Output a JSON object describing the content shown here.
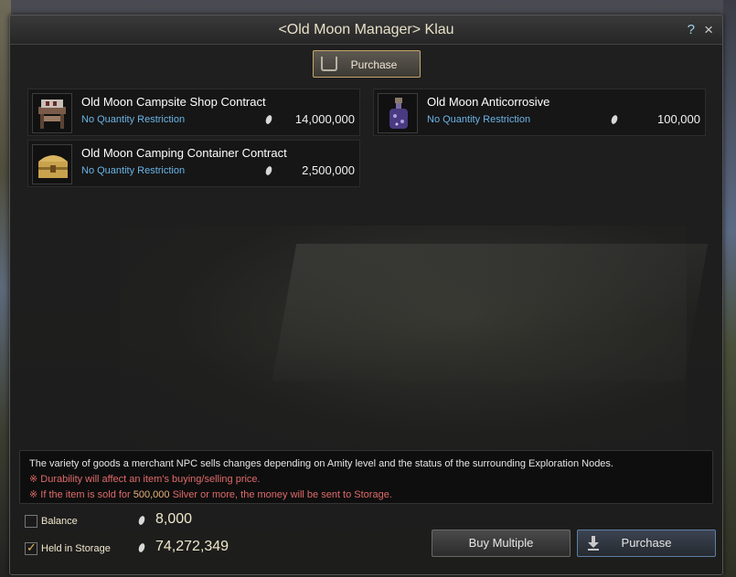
{
  "window": {
    "title": "<Old Moon Manager> Klau",
    "help_label": "?",
    "close_label": "×"
  },
  "tabs": {
    "purchase_label": "Purchase"
  },
  "items": [
    {
      "name": "Old Moon Campsite Shop Contract",
      "restriction": "No Quantity Restriction",
      "price": "14,000,000",
      "icon": "campsite-shop-icon"
    },
    {
      "name": "Old Moon Anticorrosive",
      "restriction": "No Quantity Restriction",
      "price": "100,000",
      "icon": "potion-bottle-icon"
    },
    {
      "name": "Old Moon Camping Container Contract",
      "restriction": "No Quantity Restriction",
      "price": "2,500,000",
      "icon": "treasure-chest-icon"
    }
  ],
  "info": {
    "line1": "The variety of goods a merchant NPC sells changes depending on Amity level and the status of the surrounding Exploration Nodes.",
    "line2": "※ Durability will affect an item's buying/selling price.",
    "line3_prefix": "※ If the item is sold for ",
    "line3_amount": "500,000",
    "line3_suffix": " Silver or more, the money will be sent to Storage."
  },
  "wallet": {
    "balance_label": "Balance",
    "balance_value": "8,000",
    "balance_checked": false,
    "storage_label": "Held in Storage",
    "storage_value": "74,272,349",
    "storage_checked": true
  },
  "buttons": {
    "buy_multiple": "Buy Multiple",
    "purchase": "Purchase"
  },
  "colors": {
    "accent_gold": "#c7a76a",
    "restriction_blue": "#6ab4e6",
    "warning_red": "#e06a6a"
  }
}
